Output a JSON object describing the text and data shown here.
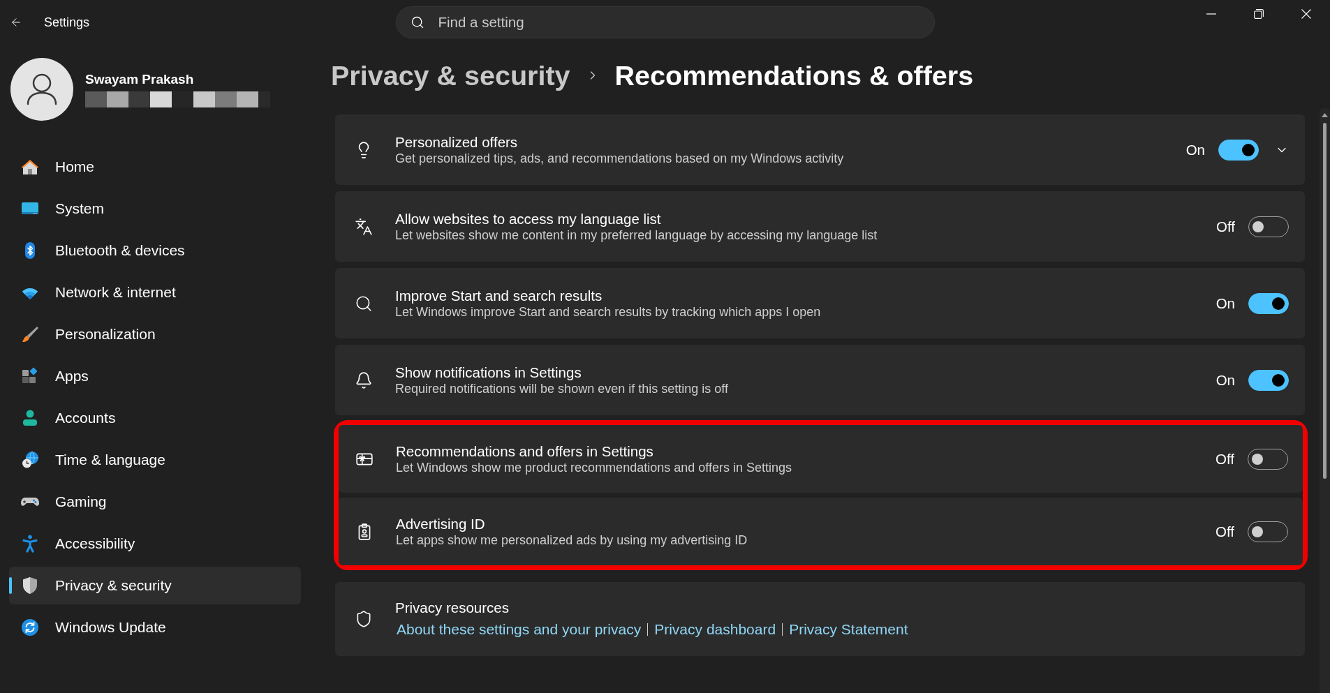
{
  "window": {
    "title": "Settings"
  },
  "search": {
    "placeholder": "Find a setting"
  },
  "user": {
    "name": "Swayam Prakash"
  },
  "sidebar": {
    "items": [
      {
        "label": "Home",
        "selected": false
      },
      {
        "label": "System",
        "selected": false
      },
      {
        "label": "Bluetooth & devices",
        "selected": false
      },
      {
        "label": "Network & internet",
        "selected": false
      },
      {
        "label": "Personalization",
        "selected": false
      },
      {
        "label": "Apps",
        "selected": false
      },
      {
        "label": "Accounts",
        "selected": false
      },
      {
        "label": "Time & language",
        "selected": false
      },
      {
        "label": "Gaming",
        "selected": false
      },
      {
        "label": "Accessibility",
        "selected": false
      },
      {
        "label": "Privacy & security",
        "selected": true
      },
      {
        "label": "Windows Update",
        "selected": false
      }
    ]
  },
  "breadcrumb": [
    {
      "label": "Privacy & security",
      "current": false
    },
    {
      "label": "Recommendations & offers",
      "current": true
    }
  ],
  "settings": [
    {
      "title": "Personalized offers",
      "description": "Get personalized tips, ads, and recommendations based on my Windows activity",
      "state_label": "On",
      "on": true,
      "expandable": true,
      "highlighted": false
    },
    {
      "title": "Allow websites to access my language list",
      "description": "Let websites show me content in my preferred language by accessing my language list",
      "state_label": "Off",
      "on": false,
      "expandable": false,
      "highlighted": false
    },
    {
      "title": "Improve Start and search results",
      "description": "Let Windows improve Start and search results by tracking which apps I open",
      "state_label": "On",
      "on": true,
      "expandable": false,
      "highlighted": false
    },
    {
      "title": "Show notifications in Settings",
      "description": "Required notifications will be shown even if this setting is off",
      "state_label": "On",
      "on": true,
      "expandable": false,
      "highlighted": false
    },
    {
      "title": "Recommendations and offers in Settings",
      "description": "Let Windows show me product recommendations and offers in Settings",
      "state_label": "Off",
      "on": false,
      "expandable": false,
      "highlighted": true
    },
    {
      "title": "Advertising ID",
      "description": "Let apps show me personalized ads by using my advertising ID",
      "state_label": "Off",
      "on": false,
      "expandable": false,
      "highlighted": true
    }
  ],
  "resources": {
    "title": "Privacy resources",
    "links": [
      "About these settings and your privacy",
      "Privacy dashboard",
      "Privacy Statement"
    ]
  }
}
